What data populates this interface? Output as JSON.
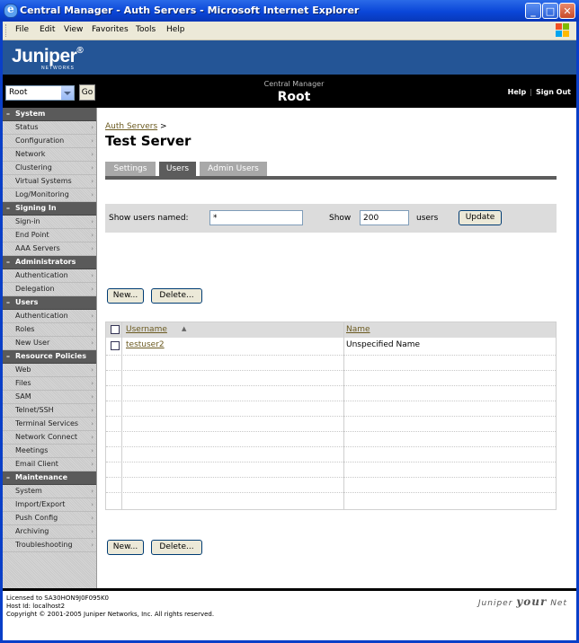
{
  "window": {
    "title": "Central Manager - Auth Servers - Microsoft Internet Explorer"
  },
  "menu": [
    "File",
    "Edit",
    "View",
    "Favorites",
    "Tools",
    "Help"
  ],
  "header": {
    "logo": "Juniper",
    "logo_sub": "NETWORKS",
    "realm_value": "Root",
    "go_label": "Go",
    "subtitle": "Central Manager",
    "title": "Root",
    "help": "Help",
    "signout": "Sign Out"
  },
  "sidebar": [
    {
      "title": "System",
      "items": [
        "Status",
        "Configuration",
        "Network",
        "Clustering",
        "Virtual Systems",
        "Log/Monitoring"
      ]
    },
    {
      "title": "Signing In",
      "items": [
        "Sign-in",
        "End Point",
        "AAA Servers"
      ]
    },
    {
      "title": "Administrators",
      "items": [
        "Authentication",
        "Delegation"
      ]
    },
    {
      "title": "Users",
      "items": [
        "Authentication",
        "Roles",
        "New User"
      ]
    },
    {
      "title": "Resource Policies",
      "items": [
        "Web",
        "Files",
        "SAM",
        "Telnet/SSH",
        "Terminal Services",
        "Network Connect",
        "Meetings",
        "Email Client"
      ]
    },
    {
      "title": "Maintenance",
      "items": [
        "System",
        "Import/Export",
        "Push Config",
        "Archiving",
        "Troubleshooting"
      ]
    }
  ],
  "main": {
    "breadcrumb": "Auth Servers",
    "breadcrumb_sep": ">",
    "page_title": "Test Server",
    "tabs": [
      "Settings",
      "Users",
      "Admin Users"
    ],
    "active_tab": "Users",
    "filter": {
      "show_named_label": "Show users named:",
      "name_value": "*",
      "show_label": "Show",
      "count_value": "200",
      "users_label": "users",
      "update_label": "Update"
    },
    "new_label": "New...",
    "delete_label": "Delete...",
    "table": {
      "col_username": "Username",
      "col_name": "Name",
      "rows": [
        {
          "username": "testuser2",
          "name": "Unspecified Name"
        }
      ]
    }
  },
  "footer": {
    "license": "Licensed to SA30HON9J0F095K0",
    "host": "Host Id: localhost2",
    "copyright": "Copyright © 2001-2005 Juniper Networks, Inc. All rights reserved.",
    "brand_a": "Juniper",
    "brand_b": "your",
    "brand_c": "Net"
  },
  "colors": {
    "banner": "#245596",
    "section": "#5a5a5a",
    "link": "#6b5a20"
  }
}
